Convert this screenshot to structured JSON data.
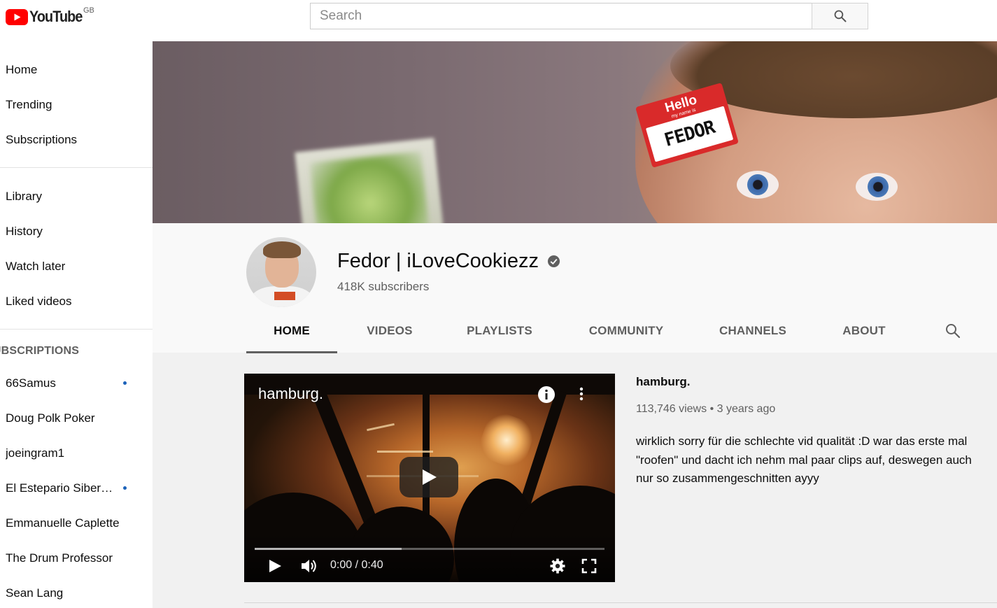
{
  "header": {
    "logo_text": "YouTube",
    "region": "GB",
    "search_placeholder": "Search"
  },
  "sidebar": {
    "main": [
      {
        "label": "Home",
        "icon": "home-icon"
      },
      {
        "label": "Trending",
        "icon": "trending-icon"
      },
      {
        "label": "Subscriptions",
        "icon": "subscriptions-icon"
      }
    ],
    "library": [
      {
        "label": "Library"
      },
      {
        "label": "History"
      },
      {
        "label": "Watch later"
      },
      {
        "label": "Liked videos"
      }
    ],
    "subscriptions_heading": "SUBSCRIPTIONS",
    "subscriptions": [
      {
        "label": "66Samus",
        "new": true
      },
      {
        "label": "Doug Polk Poker",
        "new": false
      },
      {
        "label": "joeingram1",
        "new": false
      },
      {
        "label": "El Estepario Siberiano",
        "new": true
      },
      {
        "label": "Emmanuelle Caplette",
        "new": false
      },
      {
        "label": "The Drum Professor",
        "new": false
      },
      {
        "label": "Sean Lang",
        "new": false
      }
    ]
  },
  "banner": {
    "sticker_hello": "Hello",
    "sticker_subtitle": "my name is",
    "sticker_name": "FEDOR"
  },
  "channel": {
    "name": "Fedor | iLoveCookiezz",
    "verified": true,
    "subscribers": "418K subscribers",
    "tabs": [
      "HOME",
      "VIDEOS",
      "PLAYLISTS",
      "COMMUNITY",
      "CHANNELS",
      "ABOUT"
    ],
    "active_tab": "HOME"
  },
  "featured_video": {
    "title": "hamburg.",
    "time_display": "0:00 / 0:40",
    "loaded_fraction": 0.42,
    "views": "113,746 views",
    "separator": "•",
    "age": "3 years ago",
    "description": "wirklich sorry für die schlechte vid qualität :D war das erste mal \"roofen\" und dacht ich nehm mal paar clips auf, deswegen auch nur so zusammengeschnitten ayyy"
  },
  "colors": {
    "brand_red": "#ff0000",
    "text_primary": "#0d0d0d",
    "text_secondary": "#606060",
    "unread_dot": "#1c62b9",
    "page_bg": "#f1f1f1"
  }
}
